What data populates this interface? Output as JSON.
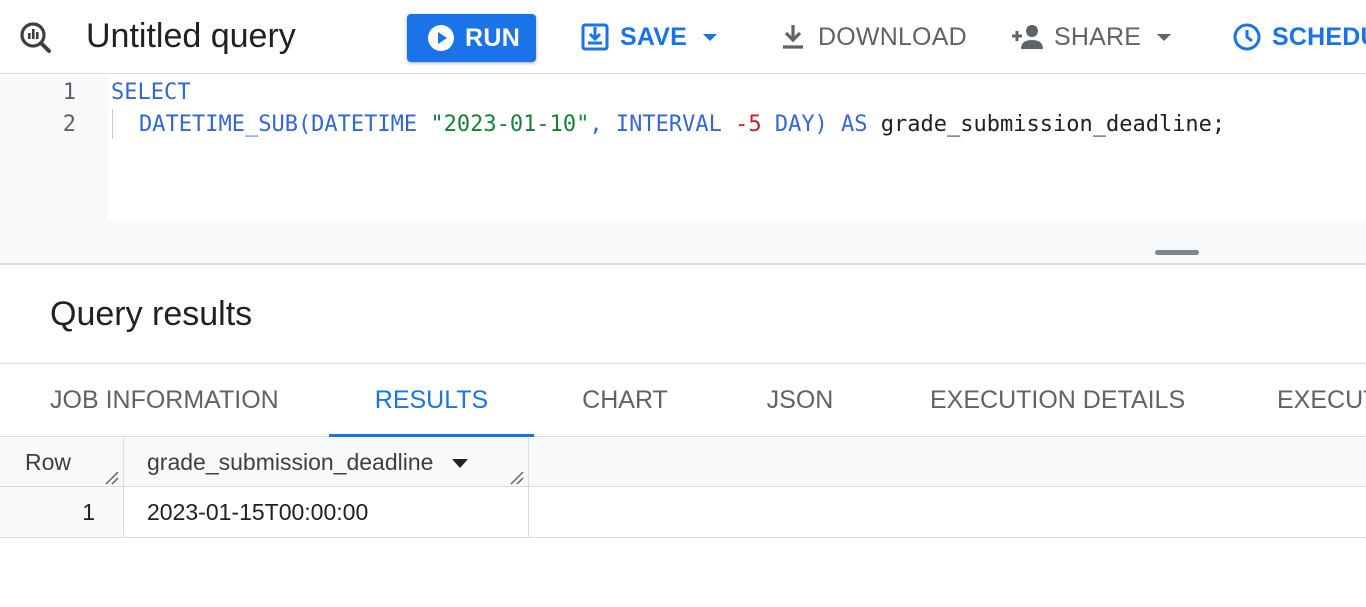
{
  "toolbar": {
    "title": "Untitled query",
    "run_label": "RUN",
    "save_label": "SAVE",
    "download_label": "DOWNLOAD",
    "share_label": "SHARE",
    "schedule_label": "SCHEDU"
  },
  "editor": {
    "line_numbers": [
      "1",
      "2"
    ],
    "line1": {
      "kw": "SELECT"
    },
    "line2": {
      "fn": "DATETIME_SUB(DATETIME ",
      "str": "\"2023-01-10\"",
      "sep": ", ",
      "kw1": "INTERVAL ",
      "num": "-5",
      "kw2": " DAY) AS ",
      "ident": "grade_submission_deadline;"
    }
  },
  "results": {
    "title": "Query results",
    "tabs": [
      {
        "label": "JOB INFORMATION",
        "active": false
      },
      {
        "label": "RESULTS",
        "active": true
      },
      {
        "label": "CHART",
        "active": false
      },
      {
        "label": "JSON",
        "active": false
      },
      {
        "label": "EXECUTION DETAILS",
        "active": false
      },
      {
        "label": "EXECUT",
        "active": false
      }
    ],
    "table": {
      "headers": [
        "Row",
        "grade_submission_deadline"
      ],
      "rows": [
        [
          "1",
          "2023-01-15T00:00:00"
        ]
      ]
    }
  },
  "colors": {
    "accent": "#1a73e8",
    "keyword": "#3367d6",
    "string": "#188038",
    "number": "#c5221f"
  },
  "icons": [
    "query-logo-icon",
    "play-icon",
    "save-icon",
    "caret-down-icon",
    "download-icon",
    "add-person-icon",
    "clock-icon",
    "sort-caret-icon",
    "column-resize-icon"
  ]
}
